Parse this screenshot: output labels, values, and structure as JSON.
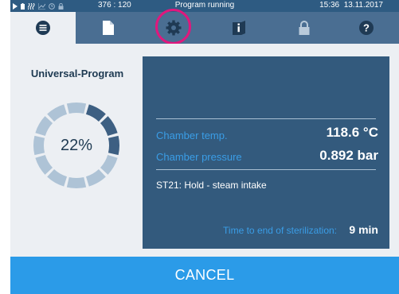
{
  "status_bar": {
    "counter": "376 : 120",
    "program_status": "Program running",
    "time": "15:36",
    "date": "13.11.2017",
    "icons": [
      "play-icon",
      "battery-icon",
      "steam-icon",
      "graph-icon",
      "clock-icon",
      "lock-icon"
    ]
  },
  "tabs": [
    {
      "name": "menu",
      "icon": "list-icon",
      "active": true
    },
    {
      "name": "document",
      "icon": "document-icon",
      "active": false
    },
    {
      "name": "settings",
      "icon": "gear-icon",
      "active": false,
      "highlighted": true
    },
    {
      "name": "info",
      "icon": "info-icon",
      "active": false
    },
    {
      "name": "lock",
      "icon": "lock-icon",
      "active": false
    },
    {
      "name": "help",
      "icon": "help-icon",
      "active": false
    }
  ],
  "program": {
    "title": "Universal-Program",
    "progress_percent": 22,
    "progress_label": "22%"
  },
  "panel": {
    "chamber_temp_label": "Chamber temp.",
    "chamber_temp_value": "118.6 °C",
    "chamber_pressure_label": "Chamber pressure",
    "chamber_pressure_value": "0.892 bar",
    "step_text": "ST21: Hold - steam intake",
    "time_remaining_label": "Time to end of sterilization:",
    "time_remaining_value": "9 min"
  },
  "cancel_label": "CANCEL",
  "colors": {
    "status_bar": "#2e5b82",
    "tab_bar": "#4a6e92",
    "content_bg": "#eceff3",
    "panel_bg": "#335a7d",
    "accent_blue": "#3a9de6",
    "cancel_bg": "#2b9be8",
    "highlight": "#e0187d",
    "progress_done": "#3d5f82",
    "progress_todo": "#aec3d6"
  }
}
